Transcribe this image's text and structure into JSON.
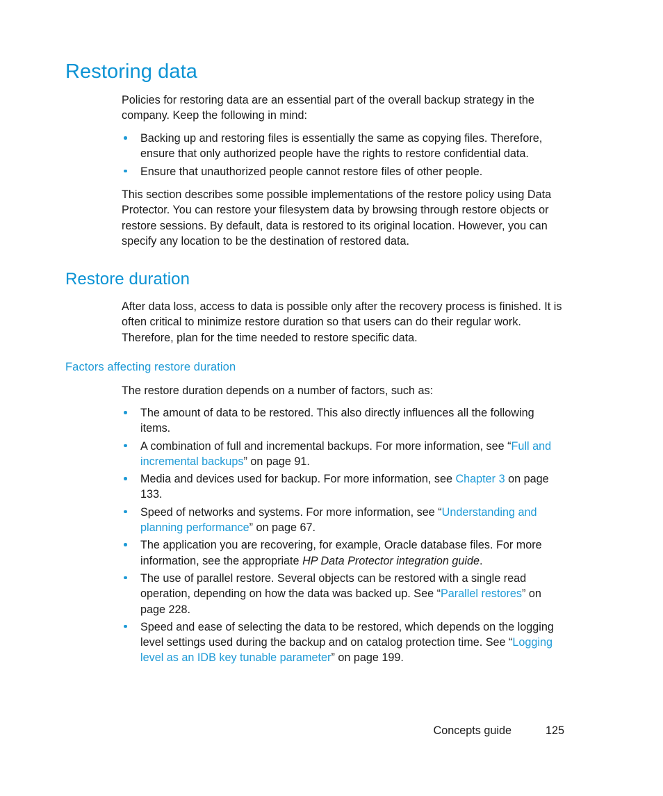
{
  "document": {
    "title": "Restoring data",
    "colors": {
      "heading_blue": "#0c93d4",
      "link_blue": "#1e9ad6",
      "body_text": "#1a1a1a",
      "page_background": "#ffffff"
    }
  },
  "sections": {
    "restoring_data": {
      "heading": "Restoring data",
      "intro_paragraph": "Policies for restoring data are an essential part of the overall backup strategy in the company. Keep the following in mind:",
      "bullets": [
        "Backing up and restoring files is essentially the same as copying files. Therefore, ensure that only authorized people have the rights to restore confidential data.",
        "Ensure that unauthorized people cannot restore files of other people."
      ],
      "closing_paragraph": "This section describes some possible implementations of the restore policy using Data Protector. You can restore your filesystem data by browsing through restore objects or restore sessions. By default, data is restored to its original location. However, you can specify any location to be the destination of restored data."
    },
    "restore_duration": {
      "heading": "Restore duration",
      "paragraph": "After data loss, access to data is possible only after the recovery process is finished. It is often critical to minimize restore duration so that users can do their regular work. Therefore, plan for the time needed to restore specific data."
    },
    "factors_affecting_restore_duration": {
      "heading": "Factors affecting restore duration",
      "intro_paragraph": "The restore duration depends on a number of factors, such as:",
      "bullets": [
        {
          "id": "amount-of-data",
          "parts": [
            {
              "type": "text",
              "value": "The amount of data to be restored. This also directly influences all the following items."
            }
          ]
        },
        {
          "id": "full-and-incremental",
          "parts": [
            {
              "type": "text",
              "value": "A combination of full and incremental backups. For more information, see “"
            },
            {
              "type": "link",
              "value": "Full and incremental backups"
            },
            {
              "type": "text",
              "value": "” on page 91."
            }
          ]
        },
        {
          "id": "media-and-devices",
          "parts": [
            {
              "type": "text",
              "value": "Media and devices used for backup. For more information, see "
            },
            {
              "type": "link",
              "value": "Chapter 3"
            },
            {
              "type": "text",
              "value": " on page 133."
            }
          ]
        },
        {
          "id": "speed-of-networks",
          "parts": [
            {
              "type": "text",
              "value": "Speed of networks and systems. For more information, see “"
            },
            {
              "type": "link",
              "value": "Understanding and planning performance"
            },
            {
              "type": "text",
              "value": "” on page 67."
            }
          ]
        },
        {
          "id": "application-recovering",
          "parts": [
            {
              "type": "text",
              "value": "The application you are recovering, for example, Oracle database files. For more information, see the appropriate "
            },
            {
              "type": "italic",
              "value": "HP Data Protector integration guide"
            },
            {
              "type": "text",
              "value": "."
            }
          ]
        },
        {
          "id": "parallel-restore",
          "parts": [
            {
              "type": "text",
              "value": "The use of parallel restore. Several objects can be restored with a single read operation, depending on how the data was backed up. See “"
            },
            {
              "type": "link",
              "value": "Parallel restores"
            },
            {
              "type": "text",
              "value": "” on page 228."
            }
          ]
        },
        {
          "id": "speed-and-ease",
          "parts": [
            {
              "type": "text",
              "value": "Speed and ease of selecting the data to be restored, which depends on the logging level settings used during the backup and on catalog protection time. See “"
            },
            {
              "type": "link",
              "value": "Logging level as an IDB key tunable parameter"
            },
            {
              "type": "text",
              "value": "” on page 199."
            }
          ]
        }
      ]
    }
  },
  "footer": {
    "guide_name": "Concepts guide",
    "page_number": "125"
  }
}
